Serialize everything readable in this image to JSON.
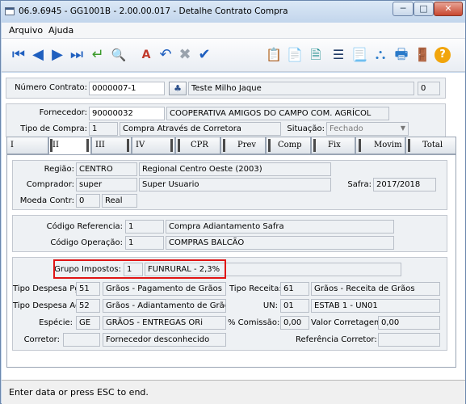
{
  "window": {
    "title": "06.9.6945 - GG1001B - 2.00.00.017 - Detalhe Contrato Compra",
    "min": "─",
    "max": "□",
    "close": "✕"
  },
  "menu": {
    "items": [
      "Arquivo",
      "Ajuda"
    ]
  },
  "toolbar": {
    "first": "⏮",
    "prev": "◀",
    "next": "▶",
    "last": "⏭",
    "goto": "↵",
    "search": "🔍",
    "edit": "A",
    "undo": "↶",
    "delete": "✖",
    "check": "✔",
    "copy": "📋",
    "notes": "📄",
    "add": "🗎",
    "list": "☰",
    "doc": "📃",
    "tree": "⛬",
    "print": "🖶",
    "exit": "🚪",
    "help": "?"
  },
  "header": {
    "numero_contrato_label": "Número Contrato:",
    "numero_contrato": "0000007-1",
    "descricao": "Teste Milho Jaque",
    "seq": "0"
  },
  "fornecedor": {
    "label": "Fornecedor:",
    "codigo": "90000032",
    "nome": "COOPERATIVA AMIGOS DO CAMPO COM. AGRÍCOL",
    "tipo_compra_label": "Tipo de Compra:",
    "tipo_compra_cod": "1",
    "tipo_compra_desc": "Compra Através de Corretora",
    "situacao_label": "Situação:",
    "situacao": "Fechado"
  },
  "tabs": [
    "I",
    "II",
    "III",
    "IV",
    "CPR",
    "Prev",
    "Comp",
    "Fix",
    "Movim",
    "Total"
  ],
  "regiao": {
    "label": "Região:",
    "codigo": "CENTRO",
    "desc": "Regional Centro Oeste (2003)",
    "comprador_label": "Comprador:",
    "comprador": "super",
    "comprador_desc": "Super Usuario",
    "safra_label": "Safra:",
    "safra": "2017/2018",
    "moeda_label": "Moeda Contr:",
    "moeda": "0",
    "moeda_desc": "Real"
  },
  "ref": {
    "cod_ref_label": "Código Referencia:",
    "cod_ref": "1",
    "cod_ref_desc": "Compra Adiantamento Safra",
    "cod_op_label": "Código Operação:",
    "cod_op": "1",
    "cod_op_desc": "COMPRAS BALCÃO"
  },
  "impostos": {
    "grupo_label": "Grupo Impostos:",
    "grupo": "1",
    "grupo_desc": "FUNRURAL - 2,3%",
    "tdp_label": "Tipo Despesa Pgto:",
    "tdp": "51",
    "tdp_desc": "Grãos - Pagamento de Grãos",
    "tr_label": "Tipo Receita:",
    "tr": "61",
    "tr_desc": "Grãos - Receita de Grãos",
    "tda_label": "Tipo Despesa Adto:",
    "tda": "52",
    "tda_desc": "Grãos - Adiantamento de Grãos",
    "un_label": "UN:",
    "un": "01",
    "un_desc": "ESTAB 1 - UN01",
    "especie_label": "Espécie:",
    "especie": "GE",
    "especie_desc": "GRÃOS - ENTREGAS ORi",
    "comissao_label": "% Comissão:",
    "comissao": "0,00",
    "valor_corr_label": "Valor Corretagem:",
    "valor_corr": "0,00",
    "corretor_label": "Corretor:",
    "corretor": "",
    "corretor_desc": "Fornecedor desconhecido",
    "ref_corr_label": "Referência Corretor:",
    "ref_corr": ""
  },
  "status": {
    "text": "Enter data or press ESC to end."
  }
}
